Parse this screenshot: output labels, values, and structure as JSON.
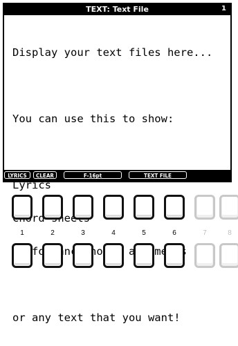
{
  "window": {
    "title": "TEXT: Text File",
    "page_number": "1"
  },
  "text_file": {
    "lines": [
      "Display your text files here...",
      "",
      "You can use this to show:",
      "",
      "Lyrics",
      "Chord sheets",
      "Performance notes and memos",
      "",
      "or any text that you want!"
    ]
  },
  "softkeys": {
    "lyrics": "LYRICS",
    "clear": "CLEAR",
    "font": "F-16pt",
    "text_file": "TEXT FILE"
  },
  "buttons": {
    "numbers": [
      "1",
      "2",
      "3",
      "4",
      "5",
      "6",
      "7",
      "8"
    ]
  }
}
